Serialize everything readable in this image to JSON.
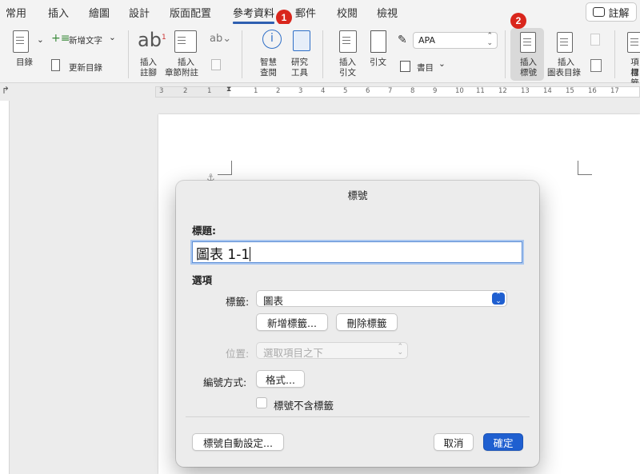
{
  "tabs": [
    "常用",
    "插入",
    "繪圖",
    "設計",
    "版面配置",
    "參考資料",
    "郵件",
    "校閱",
    "檢視"
  ],
  "active_tab_index": 5,
  "comment_button": "註解",
  "ribbon": {
    "toc": "目錄",
    "add_text": "新增文字",
    "update_toc": "更新目錄",
    "insert_footnote": [
      "插入",
      "註腳"
    ],
    "insert_endnote": [
      "插入",
      "章節附註"
    ],
    "smart_lookup": [
      "智慧",
      "查閱"
    ],
    "researcher": [
      "研究",
      "工具"
    ],
    "insert_citation": [
      "插入",
      "引文"
    ],
    "citation": "引文",
    "style_value": "APA",
    "bibliography": "書目",
    "insert_caption": [
      "插入",
      "標號"
    ],
    "insert_table_of_figures": [
      "插入",
      "圖表目錄"
    ],
    "mark_entry": [
      "項目",
      "標籤"
    ]
  },
  "badges": [
    "1",
    "2"
  ],
  "ruler_numbers": [
    "3",
    "2",
    "1",
    "1",
    "2",
    "3",
    "4",
    "5",
    "6",
    "7",
    "8",
    "9",
    "10",
    "11",
    "12",
    "13",
    "14",
    "15",
    "16",
    "17"
  ],
  "dialog": {
    "title": "標號",
    "caption_label": "標題:",
    "caption_value": "圖表 1-1",
    "options_label": "選項",
    "label_label": "標籤:",
    "label_value": "圖表",
    "new_label_button": "新增標籤...",
    "delete_label_button": "刪除標籤",
    "position_label": "位置:",
    "position_value": "選取項目之下",
    "numbering_label": "編號方式:",
    "format_button": "格式...",
    "exclude_label_checkbox": "標號不含標籤",
    "exclude_label_checked": false,
    "autocaption_button": "標號自動設定...",
    "cancel_button": "取消",
    "ok_button": "確定"
  }
}
